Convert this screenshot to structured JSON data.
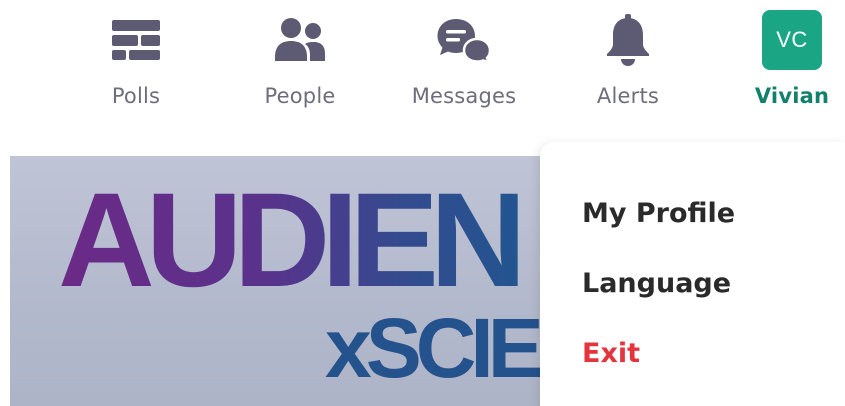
{
  "nav": {
    "items": [
      {
        "label": "Polls",
        "icon": "polls-icon"
      },
      {
        "label": "People",
        "icon": "people-icon"
      },
      {
        "label": "Messages",
        "icon": "messages-icon"
      },
      {
        "label": "Alerts",
        "icon": "bell-icon"
      }
    ],
    "user": {
      "initials": "VC",
      "name": "Vivian"
    }
  },
  "banner": {
    "line1": "AUDIEN",
    "line2": "xSCIE"
  },
  "menu": {
    "items": [
      {
        "label": "My Profile"
      },
      {
        "label": "Language"
      },
      {
        "label": "Exit"
      }
    ]
  },
  "colors": {
    "icon": "#5d5a73",
    "label": "#6e6e7a",
    "accent": "#1aa584",
    "active_label": "#13806c",
    "danger": "#e3353b"
  }
}
